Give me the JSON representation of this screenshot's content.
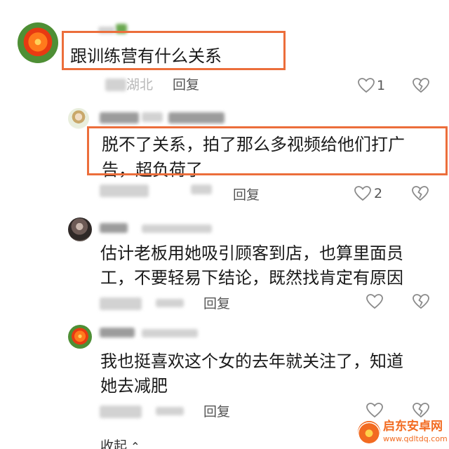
{
  "comments": [
    {
      "text": "跟训练营有什么关系",
      "meta_fragment": "湖北",
      "reply_label": "回复",
      "likes": "1"
    },
    {
      "text_line1": "脱不了关系，拍了那么多视频给他们打广",
      "text_line2": "告，超负荷了",
      "reply_label": "回复",
      "likes": "2"
    },
    {
      "text_line1": "估计老板用她吸引顾客到店，也算里面员",
      "text_line2": "工，不要轻易下结论，既然找肯定有原因",
      "reply_label": "回复"
    },
    {
      "text_line1": "我也挺喜欢这个女的去年就关注了，知道",
      "text_line2": "她去减肥",
      "reply_label": "回复"
    }
  ],
  "collapse_label": "收起",
  "watermark": {
    "name": "启东安卓网",
    "url": "www.qdltdq.com"
  },
  "colors": {
    "highlight_box": "#ec6e3b",
    "watermark_orange": "#f26b21"
  },
  "icons": {
    "like": "heart-outline",
    "dislike": "broken-heart-outline",
    "collapse": "chevron-up"
  }
}
